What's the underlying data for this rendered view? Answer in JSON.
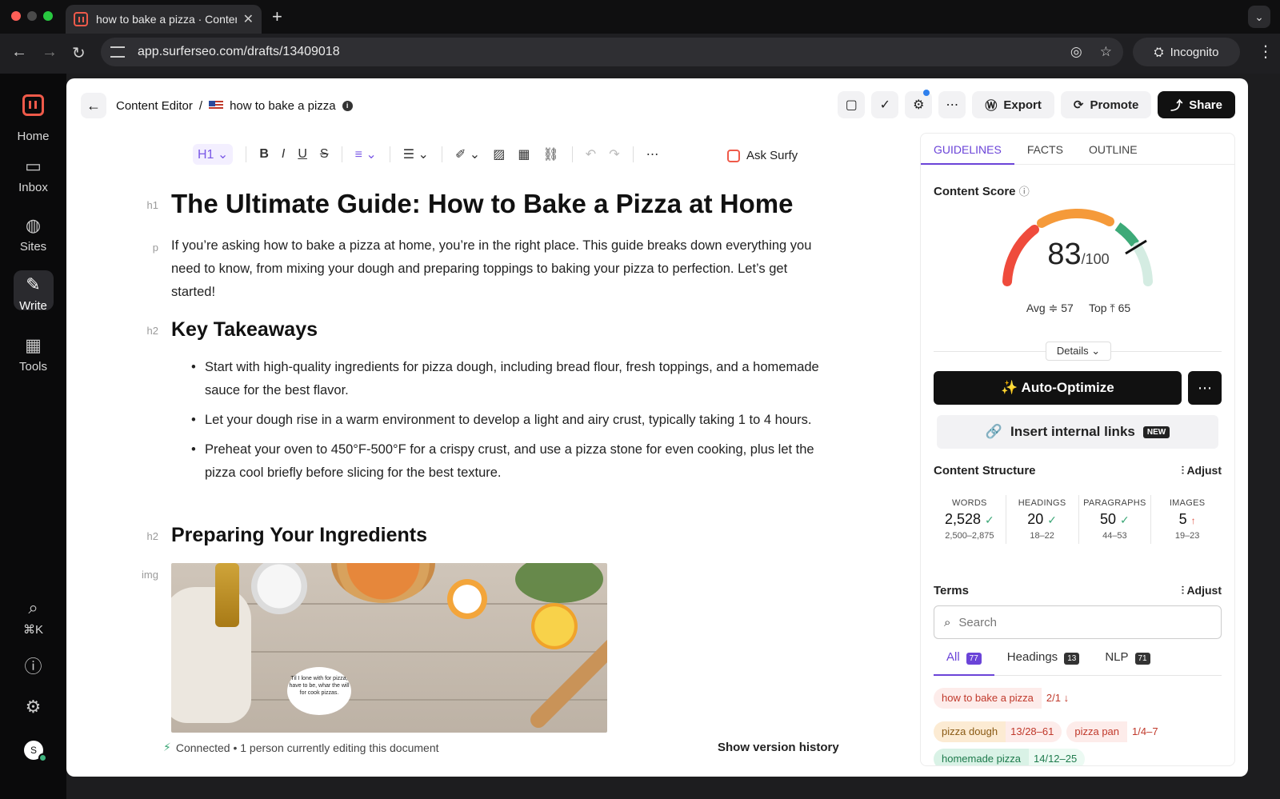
{
  "browser": {
    "tab_title": "how to bake a pizza · Content",
    "url": "app.surferseo.com/drafts/13409018",
    "incognito_label": "Incognito"
  },
  "sidebar": {
    "items": [
      {
        "label": "Home",
        "icon": "home-icon"
      },
      {
        "label": "Inbox",
        "icon": "inbox-icon"
      },
      {
        "label": "Sites",
        "icon": "globe-icon"
      },
      {
        "label": "Write",
        "icon": "write-icon"
      },
      {
        "label": "Tools",
        "icon": "grid-icon"
      }
    ],
    "shortcut_label": "⌘K",
    "avatar_initial": "S"
  },
  "header": {
    "breadcrumb_root": "Content Editor",
    "breadcrumb_sep": "/",
    "doc_name": "how to bake a pizza",
    "export_label": "Export",
    "promote_label": "Promote",
    "share_label": "Share"
  },
  "toolbar": {
    "heading_label": "H1",
    "ask_surfy_label": "Ask Surfy"
  },
  "editor": {
    "labels": {
      "h1": "h1",
      "p": "p",
      "h2": "h2",
      "img": "img"
    },
    "title": "The Ultimate Guide: How to Bake a Pizza at Home",
    "intro": "If you’re asking how to bake a pizza at home, you’re in the right place. This guide breaks down everything you need to know, from mixing your dough and preparing toppings to baking your pizza to perfection. Let’s get started!",
    "h2_takeaways": "Key Takeaways",
    "bullets": [
      "Start with high-quality ingredients for pizza dough, including bread flour, fresh toppings, and a homemade sauce for the best flavor.",
      "Let your dough rise in a warm environment to develop a light and airy crust, typically taking 1 to 4 hours.",
      "Preheat your oven to 450°F-500°F for a crispy crust, and use a pizza stone for even cooking, plus let the pizza cool briefly before slicing for the best texture."
    ],
    "h2_ingredients": "Preparing Your Ingredients",
    "image_bubble_text": "Til I lone with for pizza, have to be, whar the will for cook pizzas."
  },
  "status": {
    "connection": "Connected • 1 person currently editing this document",
    "version_history": "Show version history"
  },
  "panel": {
    "tabs": [
      "GUIDELINES",
      "FACTS",
      "OUTLINE"
    ],
    "content_score_title": "Content Score",
    "score": "83",
    "score_max": "/100",
    "avg_label": "Avg",
    "avg_value": "57",
    "top_label": "Top",
    "top_value": "65",
    "details_label": "Details",
    "auto_optimize_label": "✨ Auto-Optimize",
    "insert_links_label": "Insert internal links",
    "new_badge": "NEW",
    "structure_title": "Content Structure",
    "adjust_label": "Adjust",
    "stats": [
      {
        "label": "WORDS",
        "value": "2,528",
        "mark": "✓",
        "range": "2,500–2,875"
      },
      {
        "label": "HEADINGS",
        "value": "20",
        "mark": "✓",
        "range": "18–22"
      },
      {
        "label": "PARAGRAPHS",
        "value": "50",
        "mark": "✓",
        "range": "44–53"
      },
      {
        "label": "IMAGES",
        "value": "5",
        "mark": "↑",
        "range": "19–23"
      }
    ],
    "terms_title": "Terms",
    "search_placeholder": "Search",
    "filter_tabs": [
      {
        "label": "All",
        "count": "77"
      },
      {
        "label": "Headings",
        "count": "13"
      },
      {
        "label": "NLP",
        "count": "71"
      }
    ],
    "terms": [
      {
        "name": "how to bake a pizza",
        "count": "2/1 ↓",
        "status": "red"
      },
      {
        "name": "pizza dough",
        "count": "13/28–61",
        "status": "org"
      },
      {
        "name": "pizza pan",
        "count": "1/4–7",
        "status": "red"
      },
      {
        "name": "homemade pizza",
        "count": "14/12–25",
        "status": "grn"
      }
    ],
    "gauge_score_fraction": 0.83,
    "colors": {
      "red": "#ef4b3c",
      "orange": "#f59a3a",
      "green": "#3daa78",
      "light_green": "#d4ece2"
    }
  }
}
